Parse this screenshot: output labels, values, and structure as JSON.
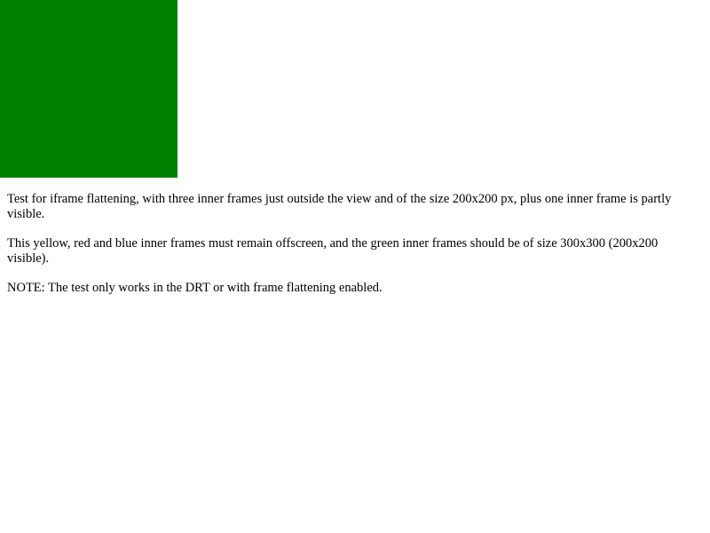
{
  "frames": {
    "green_color": "#008000"
  },
  "paragraphs": {
    "intro": "Test for iframe flattening, with three inner frames just outside the view and of the size 200x200 px, plus one inner frame is partly visible.",
    "expectation": "This yellow, red and blue inner frames must remain offscreen, and the green inner frames should be of size 300x300 (200x200 visible).",
    "note": "NOTE: The test only works in the DRT or with frame flattening enabled."
  }
}
